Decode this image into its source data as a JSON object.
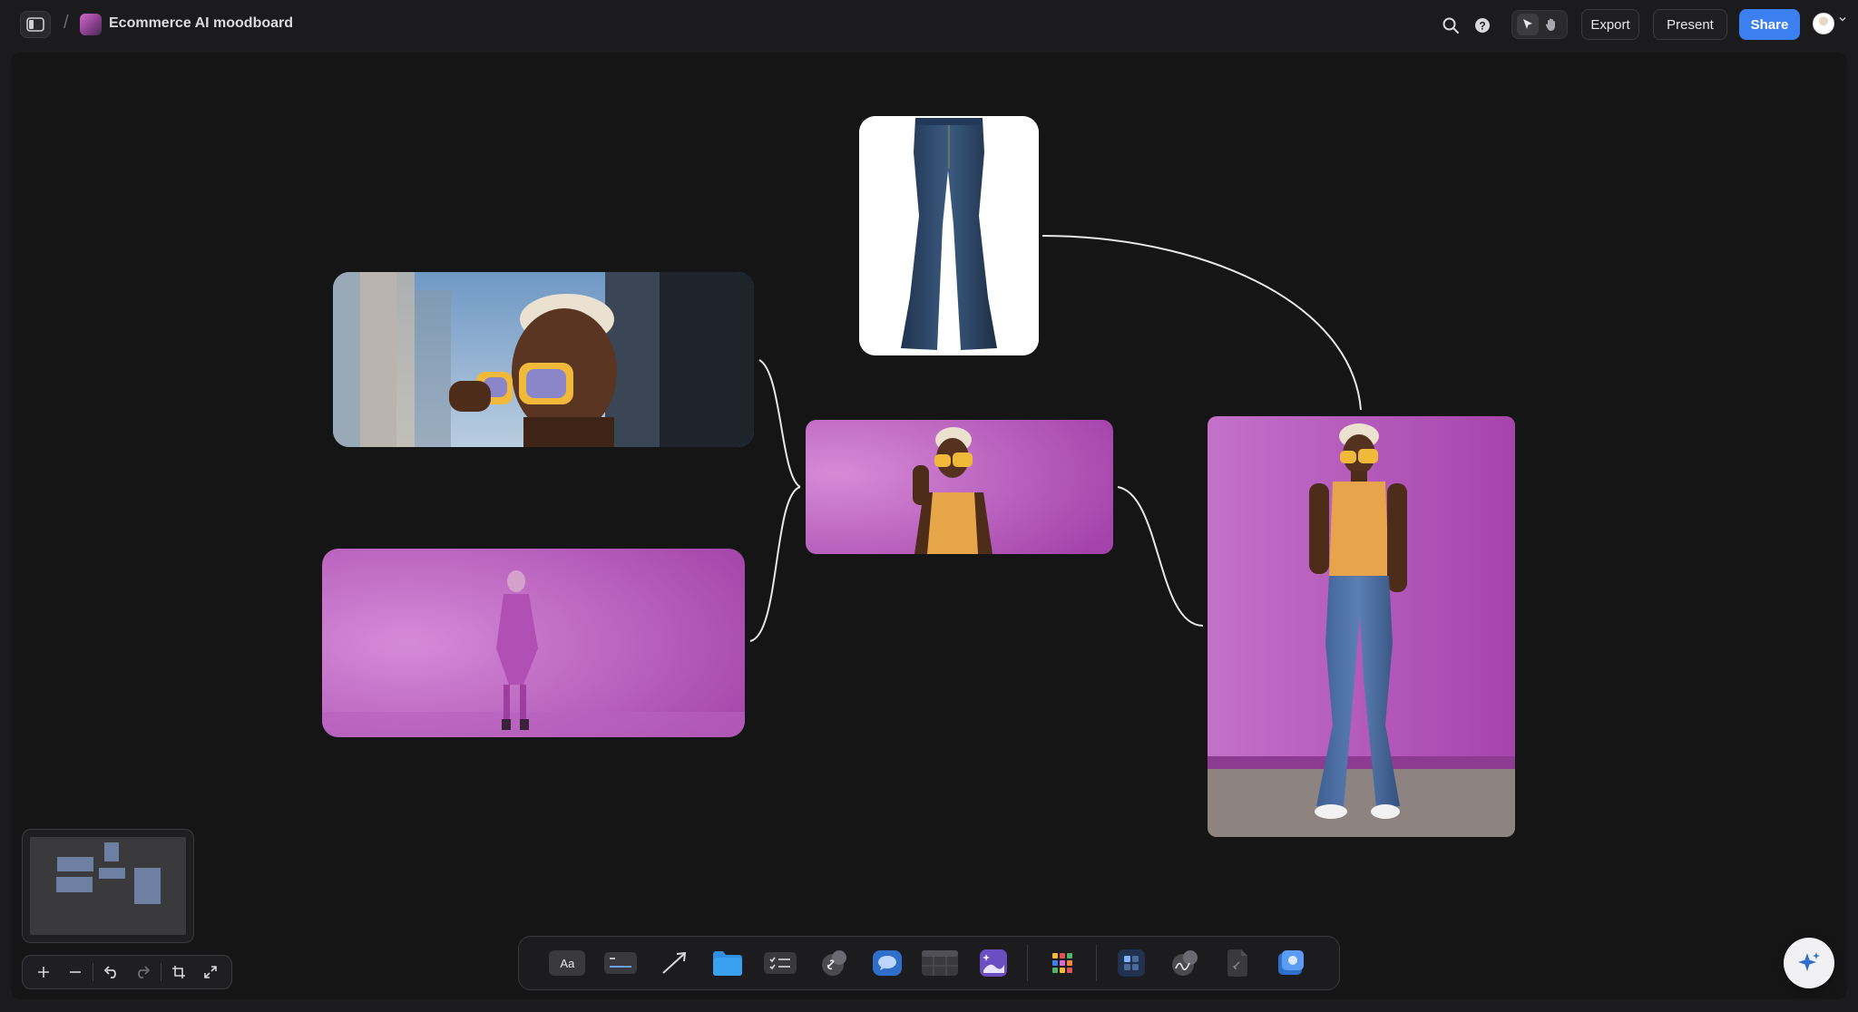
{
  "header": {
    "breadcrumb_separator": "/",
    "board_title": "Ecommerce AI moodboard",
    "export_label": "Export",
    "present_label": "Present",
    "share_label": "Share"
  },
  "icons": {
    "sidebar": "sidebar-toggle-icon",
    "search": "search-icon",
    "help": "help-icon",
    "select": "cursor-icon",
    "hand": "hand-icon",
    "ai": "sparkle-icon"
  },
  "canvas": {
    "cards": [
      {
        "id": "jeans-product",
        "alt": "flared jeans product photo"
      },
      {
        "id": "sunglasses-closeup",
        "alt": "woman with yellow sunglasses"
      },
      {
        "id": "pink-studio-dancer",
        "alt": "figure in pink studio"
      },
      {
        "id": "sunglasses-studio",
        "alt": "woman with sunglasses on pink backdrop"
      },
      {
        "id": "full-outfit",
        "alt": "full body outfit on pink backdrop"
      }
    ]
  },
  "toolbar": {
    "text_tool_label": "Aa"
  },
  "colors": {
    "accent": "#3b7ff0",
    "canvas_bg": "#151516",
    "backdrop_pink": "#b34fbc"
  }
}
